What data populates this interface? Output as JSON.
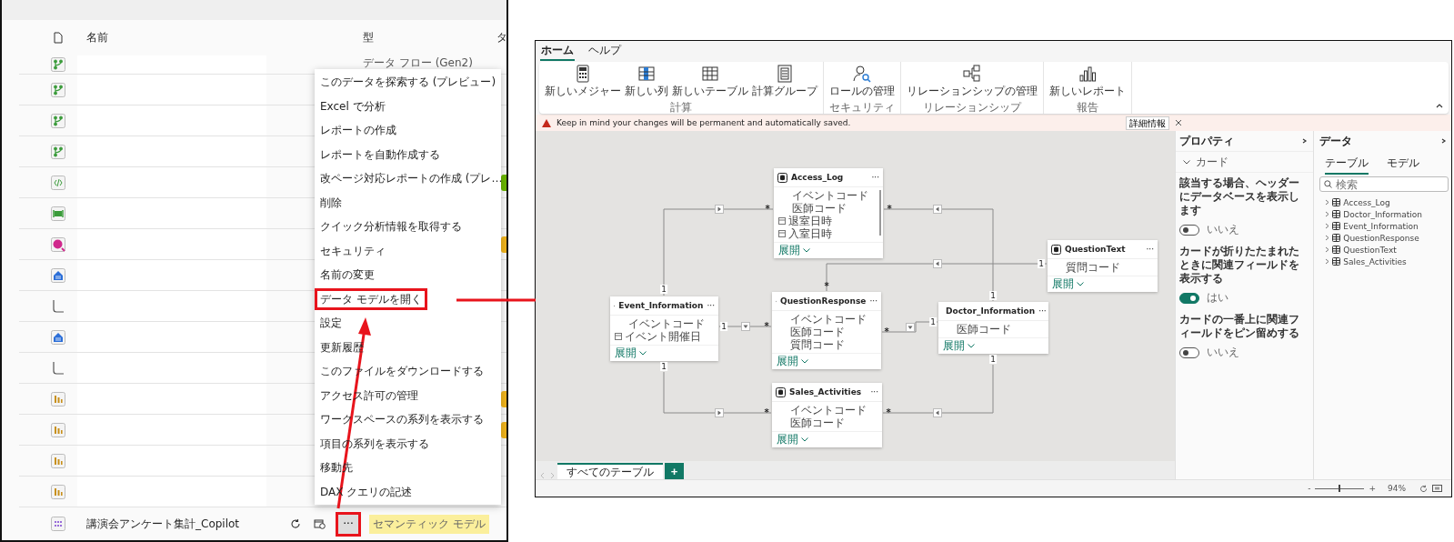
{
  "workspace_list": {
    "header": {
      "column_1": "名前",
      "column_2": "型",
      "column_3": "タ"
    },
    "rows": [
      {
        "kind": "dataflow",
        "type": "データ フロー (Gen2)"
      },
      {
        "kind": "dataflow"
      },
      {
        "kind": "dataflow"
      },
      {
        "kind": "dataflow"
      },
      {
        "kind": "notebook",
        "color": "#6bb700"
      },
      {
        "kind": "pipeline"
      },
      {
        "kind": "kql",
        "color": "#f2b51d"
      },
      {
        "kind": "warehouse"
      },
      {
        "kind": "child"
      },
      {
        "kind": "warehouse"
      },
      {
        "kind": "child"
      },
      {
        "kind": "report",
        "color": "#f2b51d"
      },
      {
        "kind": "report",
        "color": "#f2b51d"
      },
      {
        "kind": "report"
      },
      {
        "kind": "report"
      }
    ],
    "current_row": {
      "kind": "semantic",
      "name": "講演会アンケート集計_Copilot",
      "more": "···",
      "more_annotated": true,
      "type": "セマンティック モデル"
    },
    "menu": [
      {
        "label": "このデータを探索する (プレビュー)",
        "annotated": false
      },
      {
        "label": "Excel で分析",
        "annotated": false
      },
      {
        "label": "レポートの作成",
        "annotated": false
      },
      {
        "label": "レポートを自動作成する",
        "annotated": false
      },
      {
        "label": "改ページ対応レポートの作成 (プレ…",
        "annotated": false
      },
      {
        "label": "削除",
        "annotated": false
      },
      {
        "label": "クイック分析情報を取得する",
        "annotated": false
      },
      {
        "label": "セキュリティ",
        "annotated": false
      },
      {
        "label": "名前の変更",
        "annotated": false
      },
      {
        "label": "データ モデルを開く",
        "annotated": true
      },
      {
        "label": "設定",
        "annotated": false
      },
      {
        "label": "更新履歴",
        "annotated": false
      },
      {
        "label": "このファイルをダウンロードする",
        "annotated": false
      },
      {
        "label": "アクセス許可の管理",
        "annotated": false
      },
      {
        "label": "ワークスペースの系列を表示する",
        "annotated": false
      },
      {
        "label": "項目の系列を表示する",
        "annotated": false
      },
      {
        "label": "移動先",
        "annotated": false
      },
      {
        "label": "DAX クエリの記述",
        "annotated": false
      }
    ]
  },
  "model_view": {
    "tabs": [
      {
        "label": "ホーム",
        "selected": true
      },
      {
        "label": "ヘルプ",
        "selected": false
      }
    ],
    "ribbon_groups": [
      {
        "label": "計算",
        "buttons": [
          {
            "kind": "measure",
            "label": "新しいメジャー"
          },
          {
            "kind": "column",
            "label": "新しい列"
          },
          {
            "kind": "table",
            "label": "新しいテーブル"
          },
          {
            "kind": "calc_group",
            "label": "計算グループ"
          }
        ]
      },
      {
        "label": "セキュリティ",
        "buttons": [
          {
            "kind": "role",
            "label": "ロールの管理"
          }
        ]
      },
      {
        "label": "リレーションシップ",
        "buttons": [
          {
            "kind": "relationship",
            "label": "リレーションシップの管理"
          }
        ]
      },
      {
        "label": "報告",
        "buttons": [
          {
            "kind": "report",
            "label": "新しいレポート"
          }
        ]
      }
    ],
    "notice": {
      "text": "Keep in mind your changes will be permanent and automatically saved.",
      "button": "詳細情報"
    },
    "diagram": {
      "tables": [
        {
          "name": "Access_Log",
          "more": "···",
          "scrollbar": true,
          "expand": "展開",
          "fields": [
            {
              "name": "イベントコード",
              "kind": "text"
            },
            {
              "name": "医師コード",
              "kind": "text"
            },
            {
              "name": "退室日時",
              "kind": "date"
            },
            {
              "name": "入室日時",
              "kind": "date"
            }
          ]
        },
        {
          "name": "Event_Information",
          "more": "···",
          "scrollbar": false,
          "expand": "展開",
          "fields": [
            {
              "name": "イベントコード",
              "kind": "text"
            },
            {
              "name": "イベント開催日",
              "kind": "date"
            }
          ]
        },
        {
          "name": "QuestionResponse",
          "more": "···",
          "scrollbar": false,
          "expand": "展開",
          "fields": [
            {
              "name": "イベントコード",
              "kind": "text"
            },
            {
              "name": "医師コード",
              "kind": "text"
            },
            {
              "name": "質問コード",
              "kind": "text"
            }
          ]
        },
        {
          "name": "Doctor_Information",
          "more": "···",
          "scrollbar": false,
          "expand": "展開",
          "fields": [
            {
              "name": "医師コード",
              "kind": "text"
            }
          ]
        },
        {
          "name": "QuestionText",
          "more": "···",
          "scrollbar": false,
          "expand": "展開",
          "fields": [
            {
              "name": "質問コード",
              "kind": "text"
            }
          ]
        },
        {
          "name": "Sales_Activities",
          "more": "···",
          "scrollbar": false,
          "expand": "展開",
          "fields": [
            {
              "name": "イベントコード",
              "kind": "text"
            },
            {
              "name": "医師コード",
              "kind": "text"
            }
          ]
        }
      ],
      "relationships": [
        {
          "from_mark": "1",
          "to_mark": "*",
          "bidirectional": false
        },
        {
          "from_mark": "1",
          "to_mark": "*",
          "bidirectional": false
        },
        {
          "from_mark": "1",
          "to_mark": "*",
          "bidirectional": false
        },
        {
          "from_mark": "1",
          "to_mark": "*",
          "bidirectional": false
        },
        {
          "from_mark": "1",
          "to_mark": "*",
          "bidirectional": false
        },
        {
          "from_mark": "1",
          "to_mark": "*",
          "bidirectional": false
        },
        {
          "from_mark": "1",
          "to_mark": "*",
          "bidirectional": false
        }
      ]
    },
    "layout_tabs": [
      {
        "label": "すべてのテーブル",
        "selected": true
      }
    ],
    "add_tab": "+",
    "properties": {
      "title": "プロパティ",
      "section": "カード",
      "settings": [
        {
          "label": "該当する場合、ヘッダーにデータベースを表示します",
          "on": false,
          "value_label": "いいえ"
        },
        {
          "label": "カードが折りたたまれたときに関連フィールドを表示する",
          "on": true,
          "value_label": "はい"
        },
        {
          "label": "カードの一番上に関連フィールドをピン留めする",
          "on": false,
          "value_label": "いいえ"
        }
      ]
    },
    "data_pane": {
      "title": "データ",
      "tabs": [
        {
          "label": "テーブル",
          "selected": true
        },
        {
          "label": "モデル",
          "selected": false
        }
      ],
      "search": {
        "placeholder": "検索"
      },
      "tables": [
        "Access_Log",
        "Doctor_Information",
        "Event_Information",
        "QuestionResponse",
        "QuestionText",
        "Sales_Activities"
      ]
    },
    "status_bar": {
      "zoom_out": "-",
      "zoom_in": "+",
      "zoom": {
        "level": 0.48,
        "reading": "94%"
      }
    }
  }
}
